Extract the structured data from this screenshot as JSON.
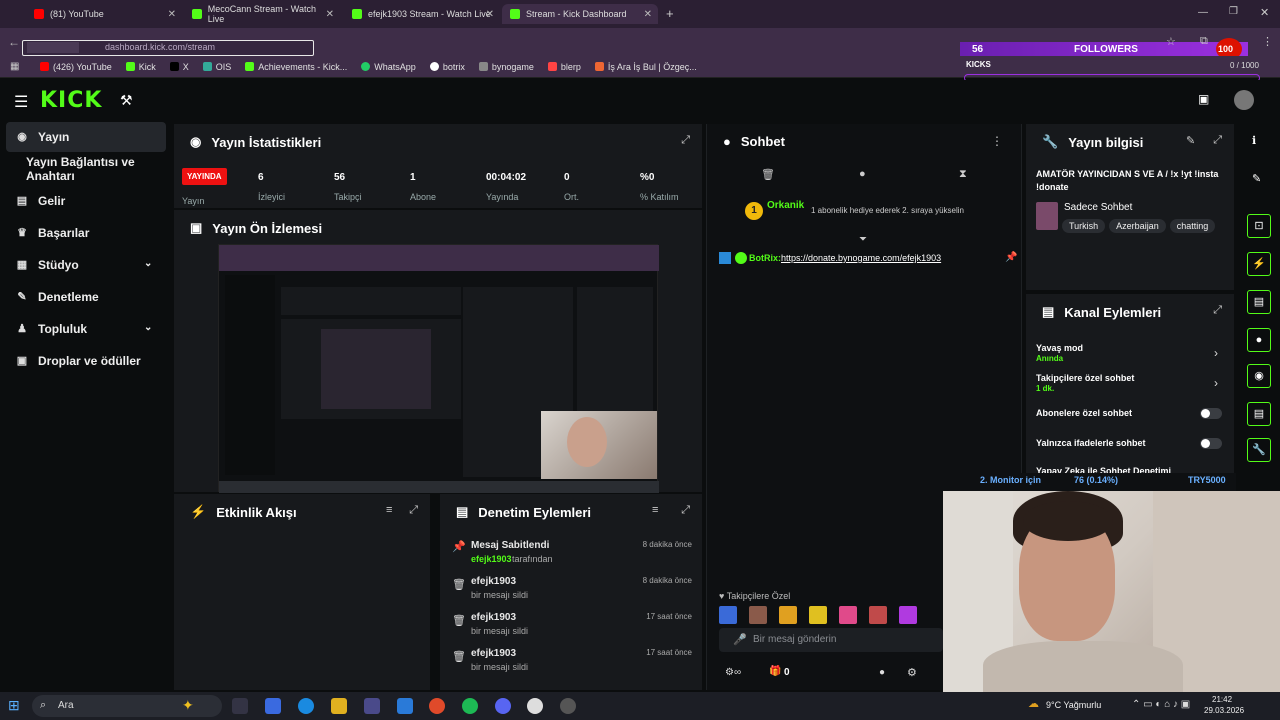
{
  "browser": {
    "tabs": [
      {
        "label": "(81) YouTube",
        "color": "#ff0000"
      },
      {
        "label": "MecoCann Stream - Watch Live",
        "color": "#53fc18"
      },
      {
        "label": "efejk1903 Stream - Watch Live",
        "color": "#53fc18"
      },
      {
        "label": "Stream - Kick Dashboard",
        "color": "#53fc18"
      }
    ],
    "url": "dashboard.kick.com/stream",
    "bookmarks": [
      "(426) YouTube",
      "Kick",
      "X",
      "OIS",
      "Achievements - Kick...",
      "WhatsApp",
      "botrix",
      "bynogame",
      "blerp",
      "İş Ara İş Bul | Özgeç..."
    ]
  },
  "overlay": {
    "followers_count": "56",
    "followers_label": "FOLLOWERS",
    "kicks_label": "KICKS",
    "kicks_value": "0 / 1000",
    "top_value": "100"
  },
  "sidebar": {
    "items": [
      {
        "label": "Yayın",
        "icon": "broadcast-icon"
      },
      {
        "label": "Yayın Bağlantısı ve Anahtarı",
        "icon": "key-icon"
      },
      {
        "label": "Gelir",
        "icon": "revenue-icon"
      },
      {
        "label": "Başarılar",
        "icon": "trophy-icon"
      },
      {
        "label": "Stüdyo",
        "icon": "studio-icon"
      },
      {
        "label": "Denetleme",
        "icon": "wrench-icon"
      },
      {
        "label": "Topluluk",
        "icon": "community-icon"
      },
      {
        "label": "Droplar ve ödüller",
        "icon": "gift-icon"
      }
    ]
  },
  "stats": {
    "title": "Yayın İstatistikleri",
    "live_badge": "YAYINDA",
    "live_label": "Yayın",
    "items": [
      {
        "value": "6",
        "label": "İzleyici"
      },
      {
        "value": "56",
        "label": "Takipçi"
      },
      {
        "value": "1",
        "label": "Abone"
      },
      {
        "value": "00:04:02",
        "label": "Yayında"
      },
      {
        "value": "0",
        "label": "Ort."
      },
      {
        "value": "%0",
        "label": "% Katılım"
      }
    ]
  },
  "preview": {
    "title": "Yayın Ön İzlemesi"
  },
  "activity": {
    "title": "Etkinlik Akışı"
  },
  "moderation": {
    "title": "Denetim Eylemleri",
    "items": [
      {
        "user": "Mesaj Sabitlendi",
        "sub_user": "efejk1903",
        "sub": "tarafından",
        "time": "8 dakika önce"
      },
      {
        "user": "efejk1903",
        "sub_user": "",
        "sub": "bir mesajı sildi",
        "time": "8 dakika önce"
      },
      {
        "user": "efejk1903",
        "sub_user": "",
        "sub": "bir mesajı sildi",
        "time": "17 saat önce"
      },
      {
        "user": "efejk1903",
        "sub_user": "",
        "sub": "bir mesajı sildi",
        "time": "17 saat önce"
      }
    ]
  },
  "chat": {
    "title": "Sohbet",
    "sub_user": "Orkanik",
    "sub_badge": "1",
    "sub_text": "1 abonelik hediye ederek 2. sıraya yükselin",
    "pinned_user": "BotRix:",
    "pinned_link": "https://donate.bynogame.com/efejk1903",
    "followers_only": "Takipçilere Özel",
    "input_placeholder": "Bir mesaj gönderin",
    "count": "0"
  },
  "info": {
    "title": "Yayın bilgisi",
    "stream_title": "AMATÖR YAYINCIDAN S VE A / !x !yt !insta !donate",
    "category": "Sadece Sohbet",
    "tags": [
      "Turkish",
      "Azerbaijan",
      "chatting"
    ]
  },
  "channel_actions": {
    "title": "Kanal Eylemleri",
    "items": [
      {
        "label": "Yavaş mod",
        "sub": "Anında",
        "control": "arrow"
      },
      {
        "label": "Takipçilere özel sohbet",
        "sub": "1 dk.",
        "control": "arrow"
      },
      {
        "label": "Abonelere özel sohbet",
        "sub": "",
        "control": "toggle"
      },
      {
        "label": "Yalnızca ifadelerle sohbet",
        "sub": "",
        "control": "toggle"
      },
      {
        "label": "Yapay Zeka ile Sohbet Denetimi",
        "sub": "",
        "control": "link"
      }
    ]
  },
  "monitor_overlay": {
    "text": "2. Monitor için",
    "mid": "76 (0.14%)",
    "right": "TRY5000"
  },
  "taskbar": {
    "search": "Ara",
    "weather": "9°C Yağmurlu",
    "time": "21:42",
    "date": "29.03.2026"
  }
}
